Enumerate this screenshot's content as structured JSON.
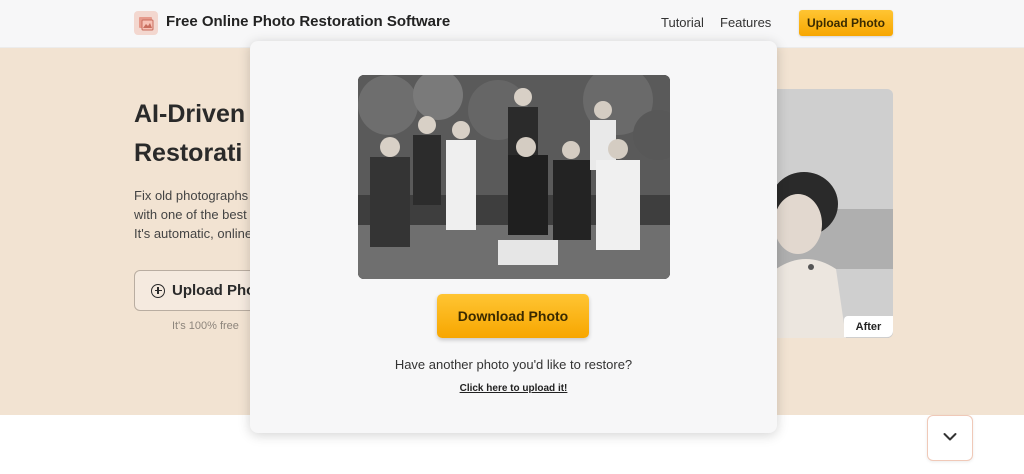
{
  "header": {
    "brand": "Free Online Photo Restoration Software",
    "nav": {
      "tutorial": "Tutorial",
      "features": "Features"
    },
    "upload_button": "Upload Photo"
  },
  "hero": {
    "title_lines": [
      "AI-Driven",
      "Restorati"
    ],
    "description_lines": [
      "Fix old photographs",
      "with one of the best",
      "It's automatic, online"
    ],
    "upload_button": "Upload Phot",
    "free_note": "It's 100% free",
    "after_label": "After"
  },
  "modal": {
    "download_button": "Download Photo",
    "another_text": "Have another photo you'd like to restore?",
    "upload_link": "Click here to upload it!"
  },
  "icons": {
    "logo": "photo-logo-icon",
    "plus": "plus-circle-icon",
    "scroll": "chevron-down-icon"
  },
  "colors": {
    "accent": "#f7a600",
    "hero_bg": "#f2e3d2"
  }
}
